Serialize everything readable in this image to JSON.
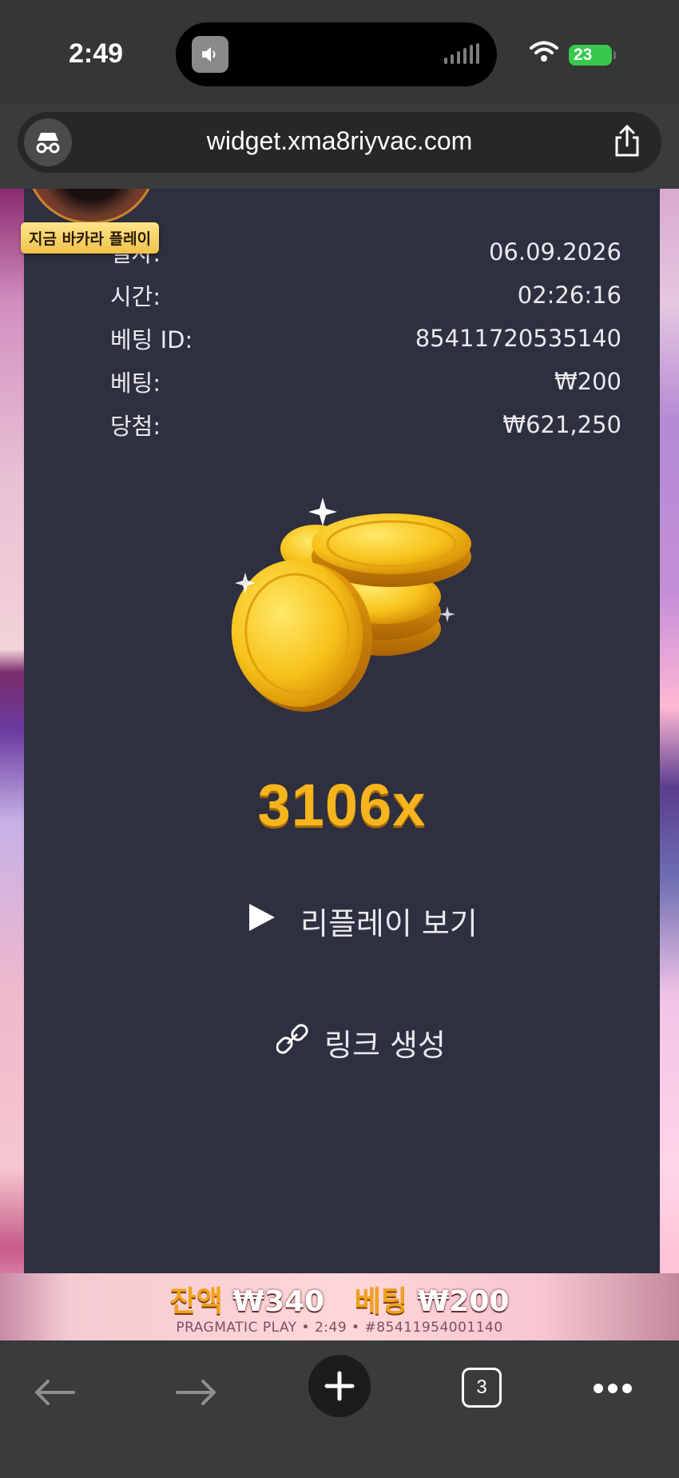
{
  "status_bar": {
    "time": "2:49",
    "battery": "23"
  },
  "address_bar": {
    "url": "widget.xma8riyvac.com"
  },
  "overlay_badge": {
    "label": "지금 바카라 플레이"
  },
  "bet_details": {
    "rows": [
      {
        "label": "일자:",
        "value": "06.09.2026"
      },
      {
        "label": "시간:",
        "value": "02:26:16"
      },
      {
        "label": "베팅 ID:",
        "value": "85411720535140"
      },
      {
        "label": "베팅:",
        "value": "₩200"
      },
      {
        "label": "당첨:",
        "value": "₩621,250"
      }
    ]
  },
  "multiplier": "3106x",
  "actions": {
    "replay_label": "리플레이 보기",
    "link_label": "링크 생성"
  },
  "game_footer": {
    "balance_label": "잔액",
    "balance_value": "₩340",
    "bet_label": "베팅",
    "bet_value": "₩200",
    "provider_line": "PRAGMATIC PLAY • 2:49 • #85411954001140"
  },
  "toolbar": {
    "tab_count": "3"
  },
  "colors": {
    "panel": "#2e2f3f",
    "multiplier": "#f6b51e",
    "accent_green": "#37c94b"
  },
  "icons": [
    "volume-icon",
    "signal-icon",
    "wifi-icon",
    "incognito-icon",
    "share-icon",
    "play-icon",
    "link-icon",
    "back-icon",
    "forward-icon",
    "plus-icon",
    "tabs-icon",
    "more-icon"
  ]
}
